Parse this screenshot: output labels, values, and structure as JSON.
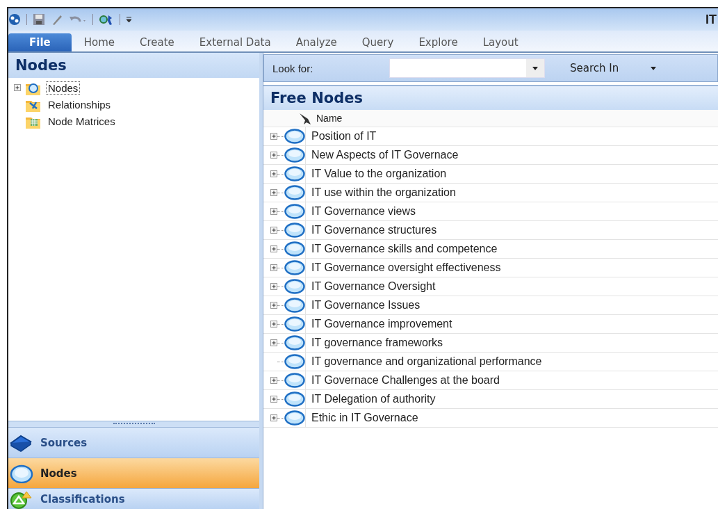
{
  "window": {
    "title": "IT"
  },
  "quick_access": [
    {
      "kind": "app"
    },
    {
      "kind": "save"
    },
    {
      "kind": "edit"
    },
    {
      "kind": "undo"
    },
    {
      "kind": "find"
    }
  ],
  "tabs": [
    {
      "label": "File",
      "selected": true
    },
    {
      "label": "Home",
      "selected": false
    },
    {
      "label": "Create",
      "selected": false
    },
    {
      "label": "External Data",
      "selected": false
    },
    {
      "label": "Analyze",
      "selected": false
    },
    {
      "label": "Query",
      "selected": false
    },
    {
      "label": "Explore",
      "selected": false
    },
    {
      "label": "Layout",
      "selected": false
    }
  ],
  "sidebar": {
    "title": "Nodes",
    "tree": [
      {
        "label": "Nodes",
        "kind": "nodes",
        "expanded": false,
        "has_children": true,
        "selected": true
      },
      {
        "label": "Relationships",
        "kind": "relationships",
        "has_children": false,
        "selected": false
      },
      {
        "label": "Node Matrices",
        "kind": "matrices",
        "has_children": false,
        "selected": false
      }
    ],
    "nav_buttons": [
      {
        "label": "Sources",
        "kind": "sources",
        "selected": false
      },
      {
        "label": "Nodes",
        "kind": "nodes",
        "selected": true
      },
      {
        "label": "Classifications",
        "kind": "classifications",
        "selected": false
      }
    ]
  },
  "search": {
    "label": "Look for:",
    "search_in": "Search In"
  },
  "list": {
    "title": "Free Nodes",
    "column": "Name",
    "rows": [
      {
        "name": "Position of IT",
        "has_children": true
      },
      {
        "name": "New Aspects of IT Governace",
        "has_children": true
      },
      {
        "name": "IT Value to the organization",
        "has_children": true
      },
      {
        "name": "IT use within the organization",
        "has_children": true
      },
      {
        "name": "IT Governance views",
        "has_children": true
      },
      {
        "name": "IT Governance structures",
        "has_children": true
      },
      {
        "name": "IT Governance skills and competence",
        "has_children": true
      },
      {
        "name": "IT Governance oversight effectiveness",
        "has_children": true
      },
      {
        "name": "IT Governance Oversight",
        "has_children": true
      },
      {
        "name": "IT Governance Issues",
        "has_children": true
      },
      {
        "name": "IT Governance improvement",
        "has_children": true
      },
      {
        "name": "IT governance frameworks",
        "has_children": true
      },
      {
        "name": "IT governance and organizational performance",
        "has_children": false
      },
      {
        "name": "IT Governace Challenges at the board",
        "has_children": true
      },
      {
        "name": "IT Delegation of authority",
        "has_children": true
      },
      {
        "name": "Ethic in IT Governace",
        "has_children": true
      }
    ]
  }
}
